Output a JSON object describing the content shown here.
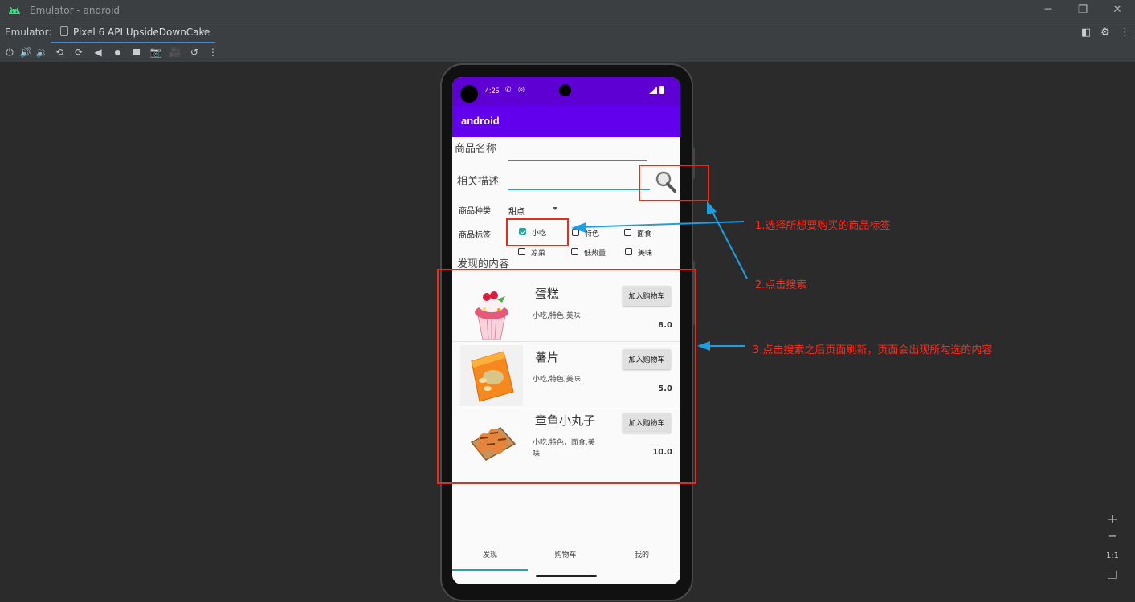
{
  "window": {
    "title": "Emulator - android"
  },
  "tabbar": {
    "label": "Emulator:",
    "tab_name": "Pixel 6 API UpsideDownCake",
    "close": "×"
  },
  "phone": {
    "status": {
      "time": "4:25"
    },
    "app_title": "android",
    "form": {
      "name_label": "商品名称",
      "desc_label": "相关描述",
      "category_label": "商品种类",
      "category_value": "甜点",
      "tags_label": "商品标签",
      "tags": [
        {
          "label": "小吃",
          "checked": true
        },
        {
          "label": "特色",
          "checked": false
        },
        {
          "label": "面食",
          "checked": false
        },
        {
          "label": "凉菜",
          "checked": false
        },
        {
          "label": "低热量",
          "checked": false
        },
        {
          "label": "美味",
          "checked": false
        }
      ],
      "found_label": "发现的内容"
    },
    "products": [
      {
        "name": "蛋糕",
        "tags": "小吃,特色,美味",
        "price": "8.0",
        "button": "加入购物车"
      },
      {
        "name": "薯片",
        "tags": "小吃,特色,美味",
        "price": "5.0",
        "button": "加入购物车"
      },
      {
        "name": "章鱼小丸子",
        "tags": "小吃,特色，面食,美味",
        "price": "10.0",
        "button": "加入购物车"
      }
    ],
    "nav": {
      "items": [
        "发现",
        "购物车",
        "我的"
      ],
      "active_index": 0
    }
  },
  "annotations": {
    "a1": "1.选择所想要购买的商品标签",
    "a2": "2.点击搜索",
    "a3": "3.点击搜索之后页面刷新，页面会出现所勾选的内容"
  },
  "zoom": {
    "plus": "+",
    "minus": "−",
    "ratio": "1:1"
  },
  "colors": {
    "accent": "#6200ee",
    "status": "#5e00d3",
    "annotation": "#e0301e",
    "arrow": "#1e9ee0",
    "teal": "#26a69a"
  }
}
